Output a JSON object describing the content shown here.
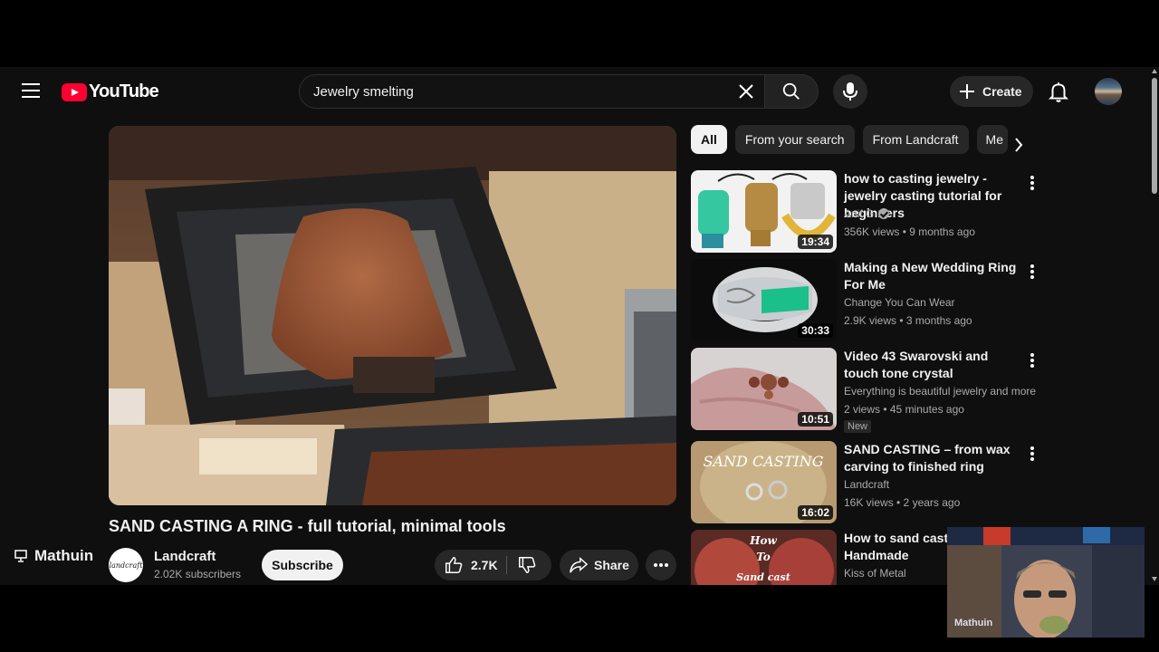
{
  "header": {
    "logo_text": "YouTube",
    "search_query": "Jewelry smelting",
    "create_label": "Create"
  },
  "video": {
    "title": "SAND CASTING A RING - full tutorial, minimal tools",
    "channel": "Landcraft",
    "channel_avatar_text": "landcraft",
    "subscribers": "2.02K subscribers",
    "subscribe_label": "Subscribe",
    "likes": "2.7K",
    "share_label": "Share"
  },
  "chips": [
    {
      "label": "All",
      "active": true
    },
    {
      "label": "From your search"
    },
    {
      "label": "From Landcraft"
    },
    {
      "label": "Me"
    }
  ],
  "recommendations": [
    {
      "title": "how to casting jewelry - jewelry casting tutorial for beginners",
      "channel": "Anif G",
      "verified": true,
      "meta": "356K views • 9 months ago",
      "duration": "19:34"
    },
    {
      "title": "Making a New Wedding Ring For Me",
      "channel": "Change You Can Wear",
      "meta": "2.9K views • 3 months ago",
      "duration": "30:33"
    },
    {
      "title": "Video 43 Swarovski and touch tone crystal",
      "channel": "Everything is beautiful jewelry and more",
      "meta": "2 views • 45 minutes ago",
      "duration": "10:51",
      "badge": "New"
    },
    {
      "title": "SAND CASTING – from wax carving to finished ring",
      "channel": "Landcraft",
      "meta": "16K views • 2 years ago",
      "duration": "16:02",
      "thumb_text": "SAND CASTING"
    },
    {
      "title": "How to sand cast a setting | Handmade",
      "channel": "Kiss of Metal",
      "meta": "",
      "duration": "",
      "thumb_text_1": "How",
      "thumb_text_2": "To",
      "thumb_text_3": "Sand cast"
    }
  ],
  "overlay": {
    "streamer_name": "Mathuin",
    "webcam_label": "Mathuin"
  }
}
